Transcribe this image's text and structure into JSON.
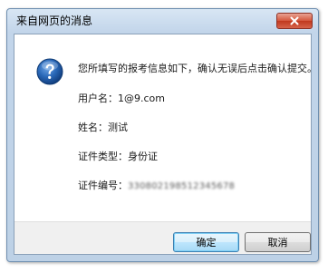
{
  "window": {
    "title": "来自网页的消息"
  },
  "message": {
    "intro": "您所填写的报考信息如下，确认无误后点击确认提交。",
    "username_label": "用户名：",
    "username_value": "1@9.com",
    "name_label": "姓名：",
    "name_value": "测试",
    "id_type_label": "证件类型：",
    "id_type_value": "身份证",
    "id_number_label": "证件编号：",
    "id_number_value": "330802198512345678"
  },
  "buttons": {
    "ok_label": "确定",
    "cancel_label": "取消"
  },
  "icons": {
    "info": "question-icon",
    "close": "close-icon"
  },
  "colors": {
    "titlebar": "#c9dbee",
    "close_button": "#c8462b",
    "info_icon": "#1f5fae",
    "ok_button_border": "#3c7fb1"
  }
}
